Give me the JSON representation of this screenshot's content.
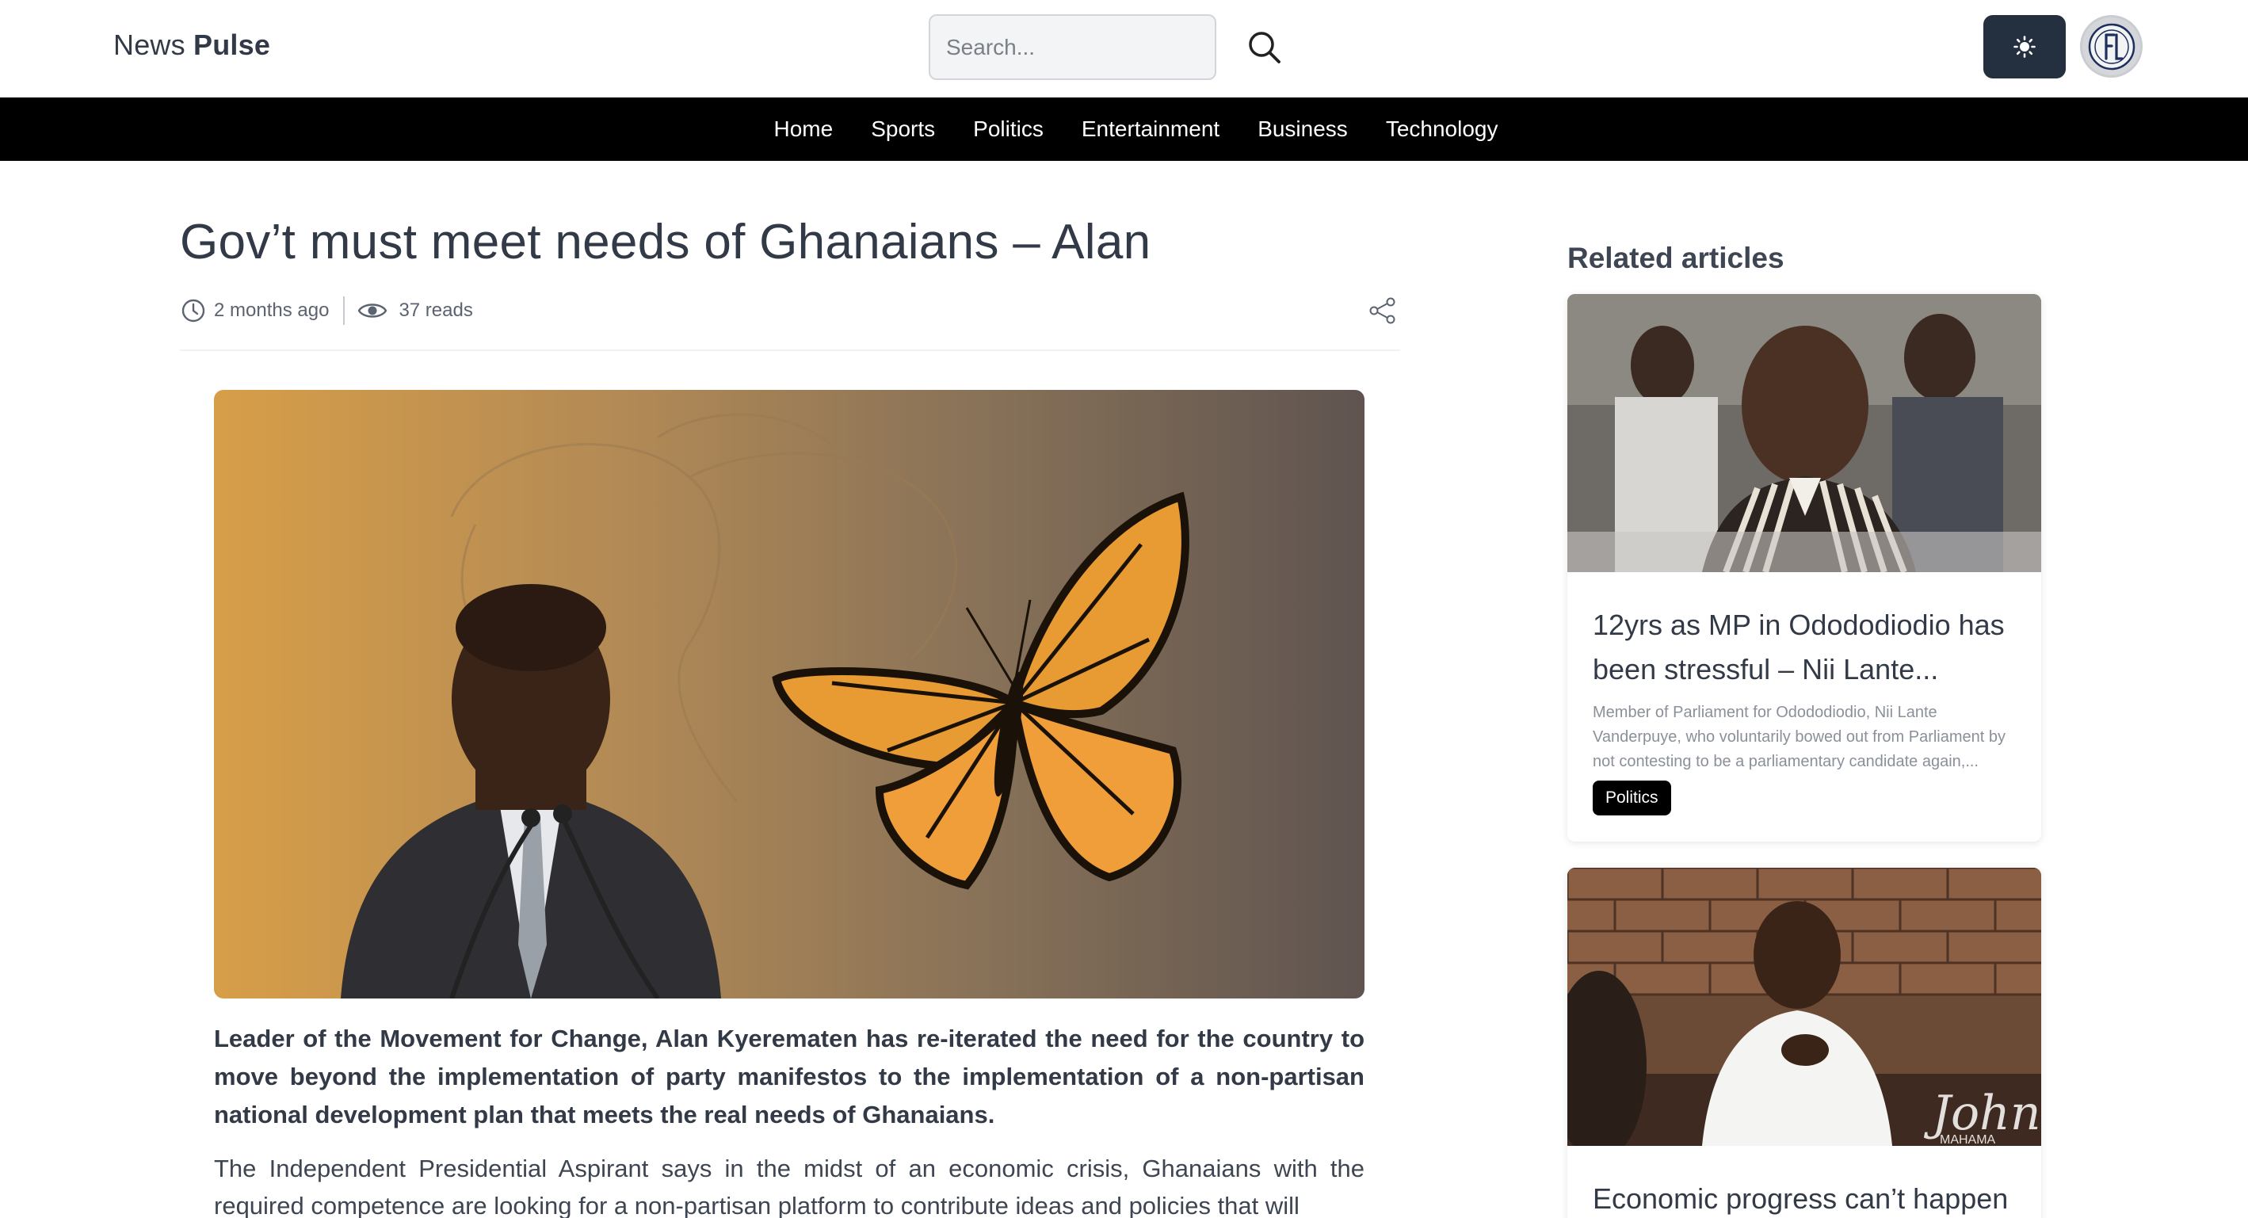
{
  "header": {
    "logo_light": "News",
    "logo_bold": "Pulse",
    "search_placeholder": "Search...",
    "search_icon": "magnifier-icon",
    "theme_toggle_icon": "sun-icon",
    "avatar_icon": "user-avatar-logo"
  },
  "nav": {
    "items": [
      "Home",
      "Sports",
      "Politics",
      "Entertainment",
      "Business",
      "Technology"
    ]
  },
  "article": {
    "title": "Gov’t must meet needs of Ghanaians – Alan",
    "time_ago": "2 months ago",
    "reads": "37 reads",
    "time_icon": "clock-icon",
    "reads_icon": "eye-icon",
    "share_icon": "share-icon",
    "lead": "Leader of the Movement for Change, Alan Kyerematen has re-iterated the need for the country to move beyond the implementation of party manifestos to the implementation of a non-partisan national development plan that meets the real needs of Ghanaians.",
    "paragraph": "The Independent Presidential Aspirant says in the midst of an economic crisis, Ghanaians with the required competence are looking for a non-partisan platform to contribute ideas and policies that will"
  },
  "sidebar": {
    "heading": "Related articles",
    "cards": [
      {
        "title": "12yrs as MP in Odododiodio has been stressful – Nii Lante...",
        "excerpt": "Member of Parliament for Odododiodio, Nii Lante Vanderpuye, who voluntarily bowed out from Parliament by not contesting to be a parliamentary candidate again,...",
        "category": "Politics"
      },
      {
        "title": "Economic progress can’t happen",
        "watermark_line1": "John",
        "watermark_line2": "MAHAMA"
      }
    ]
  },
  "colors": {
    "nav_bg": "#000000",
    "theme_button_bg": "#24303f",
    "text": "#333a47",
    "badge_bg": "#000000"
  }
}
